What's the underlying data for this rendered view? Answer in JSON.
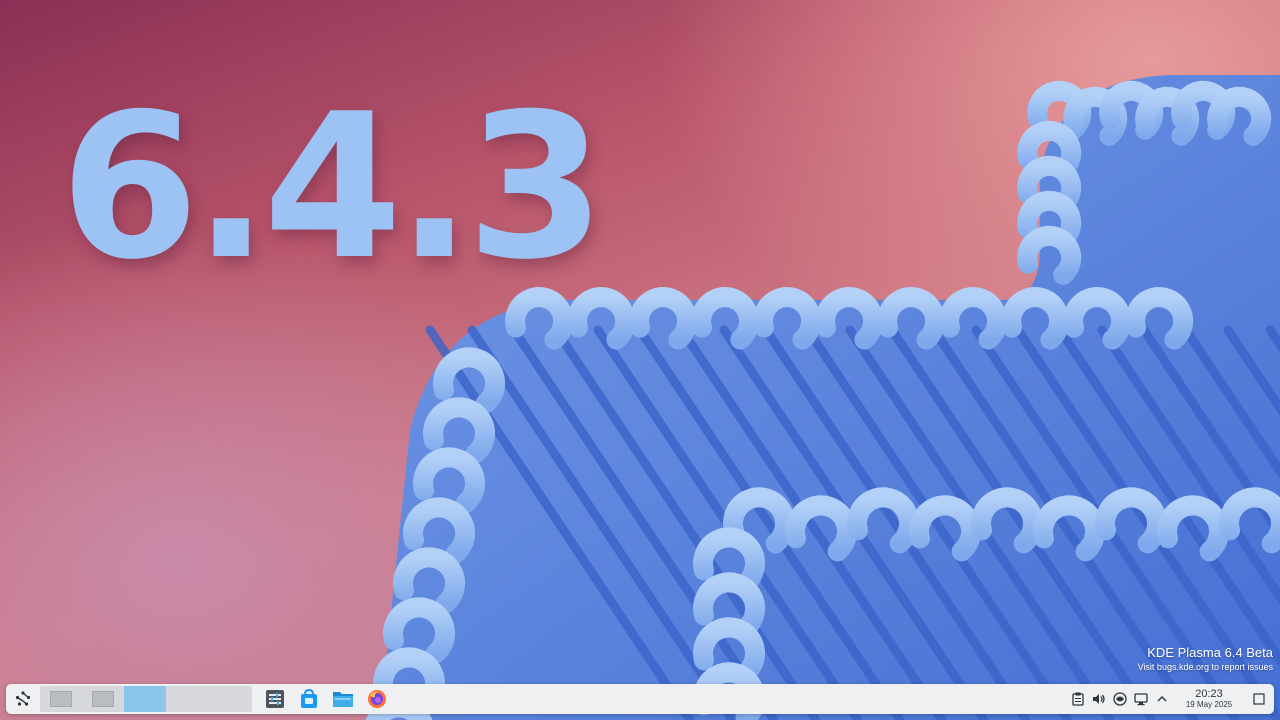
{
  "wallpaper": {
    "version_text": "6.4.3",
    "colors": {
      "background_dark": "#8a2f55",
      "background_light": "#cf7a85",
      "ribbon_blue": "#5585e0",
      "ribbon_light": "#9cc3f4"
    }
  },
  "watermark": {
    "title": "KDE Plasma 6.4 Beta",
    "subtitle": "Visit bugs.kde.org to report issues"
  },
  "panel": {
    "launcher_icon": "kde-launcher-icon",
    "pager": {
      "desktops": [
        {
          "name": "Desktop 1",
          "active": false
        },
        {
          "name": "Desktop 2",
          "active": false
        },
        {
          "name": "Desktop 3",
          "active": true
        },
        {
          "name": "Desktop 4",
          "active": false
        }
      ]
    },
    "tasks": [
      {
        "name": "System Settings",
        "icon": "system-settings-icon"
      },
      {
        "name": "Discover",
        "icon": "discover-store-icon"
      },
      {
        "name": "Dolphin",
        "icon": "folder-icon"
      },
      {
        "name": "Firefox",
        "icon": "firefox-icon"
      }
    ],
    "tray": {
      "icons": [
        "clipboard-icon",
        "volume-icon",
        "network-icon",
        "display-icon",
        "chevron-up-icon"
      ],
      "clock": {
        "time": "20:23",
        "date": "19 May 2025"
      },
      "show_desktop_icon": "show-desktop-icon"
    },
    "accent": "#3daee9"
  }
}
